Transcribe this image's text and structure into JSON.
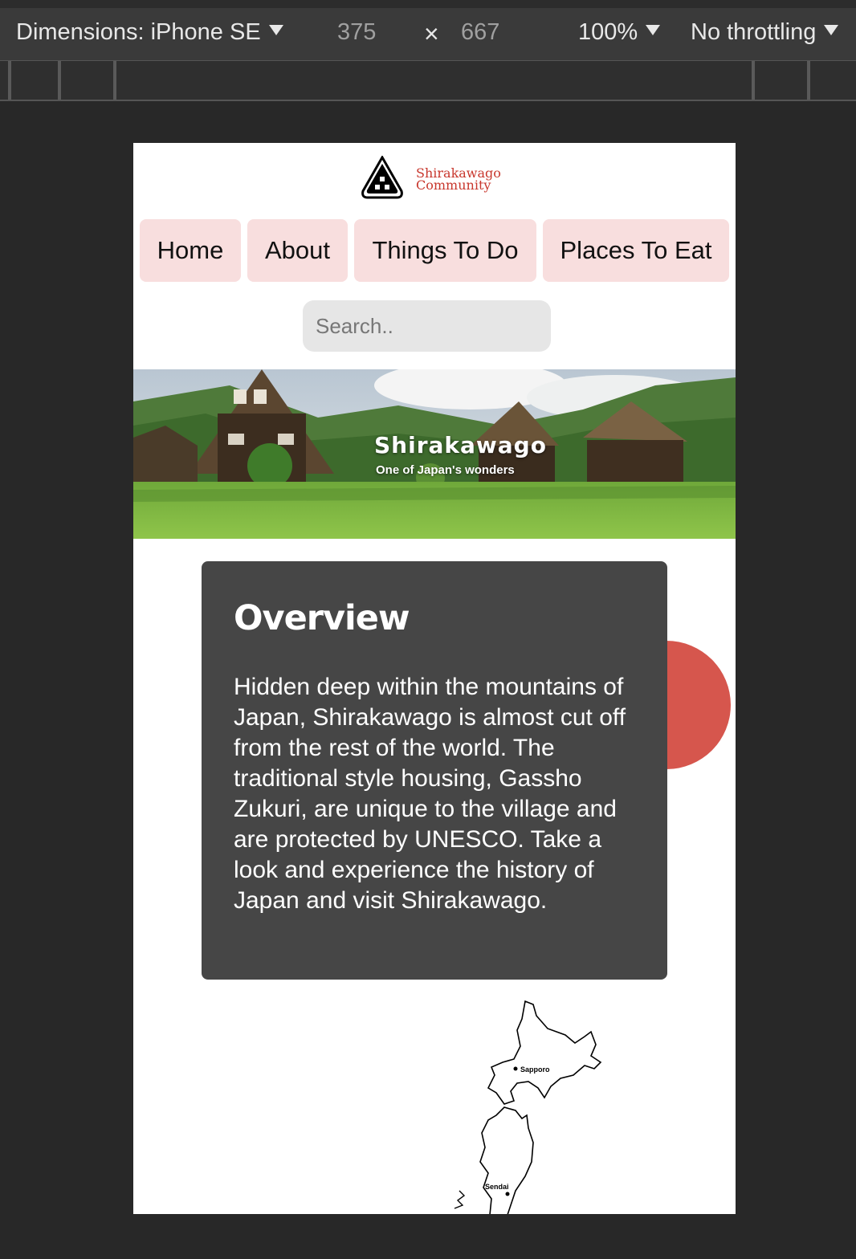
{
  "devtools": {
    "dimensions_label": "Dimensions: iPhone SE",
    "width": "375",
    "times": "×",
    "height": "667",
    "zoom": "100%",
    "throttling": "No throttling"
  },
  "site": {
    "logo_line1": "Shirakawago",
    "logo_line2": "Community",
    "nav": [
      {
        "label": "Home"
      },
      {
        "label": "About"
      },
      {
        "label": "Things To Do"
      },
      {
        "label": "Places To Eat"
      }
    ],
    "search_placeholder": "Search..",
    "hero": {
      "title": "Shirakawago",
      "subtitle": "One of Japan's wonders"
    },
    "overview": {
      "heading": "Overview",
      "body": "Hidden deep within the mountains of Japan, Shirakawago is almost cut off from the rest of the world. The traditional style housing, Gassho Zukuri, are unique to the village and are protected by UNESCO. Take a look and experience the history of Japan and visit Shirakawago."
    },
    "map_labels": {
      "city1": "Sapporo",
      "city2": "Sendai"
    }
  },
  "colors": {
    "accent": "#c8372d",
    "nav_bg": "#f8dede",
    "card_bg": "#464646",
    "circle": "#d6564d"
  }
}
